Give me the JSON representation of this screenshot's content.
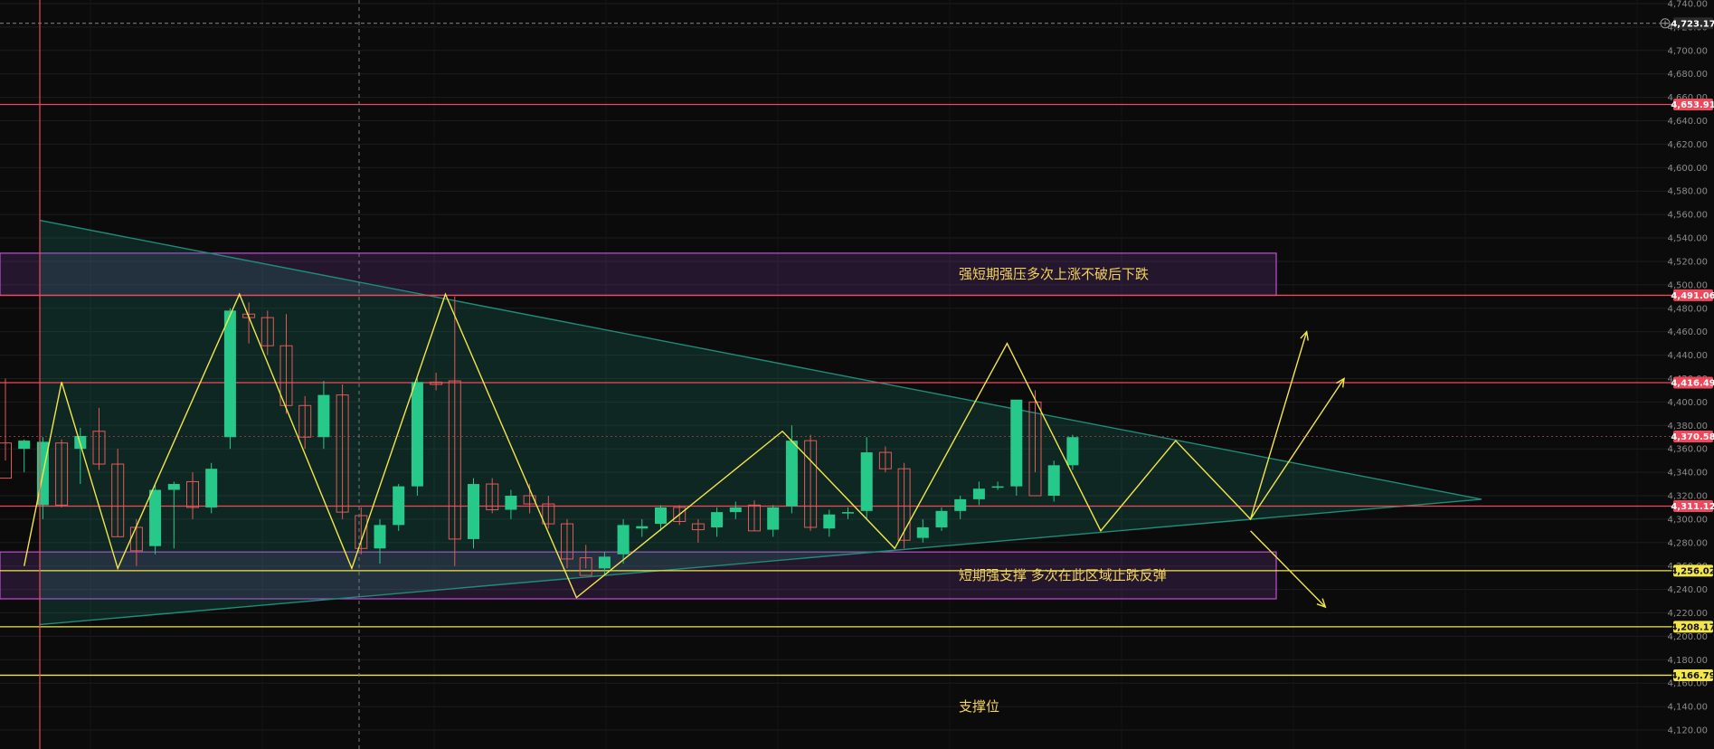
{
  "chart_data": {
    "type": "candlestick",
    "ylim": [
      4110,
      4740
    ],
    "y_ticks": [
      "4,740.00",
      "4,720.00",
      "4,700.00",
      "4,680.00",
      "4,660.00",
      "4,640.00",
      "4,620.00",
      "4,600.00",
      "4,580.00",
      "4,560.00",
      "4,540.00",
      "4,520.00",
      "4,500.00",
      "4,480.00",
      "4,460.00",
      "4,440.00",
      "4,420.00",
      "4,400.00",
      "4,380.00",
      "4,360.00",
      "4,340.00",
      "4,320.00",
      "4,300.00",
      "4,280.00",
      "4,260.00",
      "4,240.00",
      "4,220.00",
      "4,200.00",
      "4,180.00",
      "4,160.00",
      "4,140.00",
      "4,120.00"
    ],
    "grid": true,
    "colors": {
      "background": "#0b0b0b",
      "up": "#26c98a",
      "down": "#e05a5a",
      "red_line": "#f0485a",
      "yellow_line": "#f2e64b",
      "zigzag": "#f2e64b",
      "triangle": "#1f8c7a",
      "zone_border": "#c24dd8",
      "zone_label": "#f2d35b"
    },
    "candles": [
      {
        "o": 4365,
        "h": 4420,
        "l": 4350,
        "c": 4335
      },
      {
        "o": 4360,
        "h": 4368,
        "l": 4340,
        "c": 4367
      },
      {
        "o": 4312,
        "h": 4370,
        "l": 4300,
        "c": 4366
      },
      {
        "o": 4365,
        "h": 4368,
        "l": 4310,
        "c": 4312
      },
      {
        "o": 4360,
        "h": 4378,
        "l": 4330,
        "c": 4371
      },
      {
        "o": 4375,
        "h": 4395,
        "l": 4342,
        "c": 4347
      },
      {
        "o": 4347,
        "h": 4360,
        "l": 4285,
        "c": 4285
      },
      {
        "o": 4293,
        "h": 4300,
        "l": 4260,
        "c": 4273
      },
      {
        "o": 4277,
        "h": 4330,
        "l": 4270,
        "c": 4325
      },
      {
        "o": 4325,
        "h": 4332,
        "l": 4275,
        "c": 4330
      },
      {
        "o": 4332,
        "h": 4340,
        "l": 4300,
        "c": 4310
      },
      {
        "o": 4310,
        "h": 4348,
        "l": 4305,
        "c": 4343
      },
      {
        "o": 4370,
        "h": 4480,
        "l": 4360,
        "c": 4478
      },
      {
        "o": 4475,
        "h": 4485,
        "l": 4450,
        "c": 4472
      },
      {
        "o": 4472,
        "h": 4478,
        "l": 4440,
        "c": 4448
      },
      {
        "o": 4448,
        "h": 4475,
        "l": 4390,
        "c": 4397
      },
      {
        "o": 4397,
        "h": 4405,
        "l": 4360,
        "c": 4370
      },
      {
        "o": 4370,
        "h": 4418,
        "l": 4360,
        "c": 4406
      },
      {
        "o": 4406,
        "h": 4415,
        "l": 4300,
        "c": 4306
      },
      {
        "o": 4303,
        "h": 4310,
        "l": 4270,
        "c": 4275
      },
      {
        "o": 4275,
        "h": 4300,
        "l": 4262,
        "c": 4295
      },
      {
        "o": 4295,
        "h": 4330,
        "l": 4290,
        "c": 4328
      },
      {
        "o": 4328,
        "h": 4420,
        "l": 4320,
        "c": 4417
      },
      {
        "o": 4417,
        "h": 4425,
        "l": 4410,
        "c": 4415
      },
      {
        "o": 4418,
        "h": 4490,
        "l": 4260,
        "c": 4283
      },
      {
        "o": 4283,
        "h": 4335,
        "l": 4275,
        "c": 4330
      },
      {
        "o": 4330,
        "h": 4335,
        "l": 4305,
        "c": 4308
      },
      {
        "o": 4308,
        "h": 4325,
        "l": 4300,
        "c": 4320
      },
      {
        "o": 4320,
        "h": 4330,
        "l": 4305,
        "c": 4313
      },
      {
        "o": 4313,
        "h": 4320,
        "l": 4292,
        "c": 4296
      },
      {
        "o": 4296,
        "h": 4300,
        "l": 4258,
        "c": 4266
      },
      {
        "o": 4267,
        "h": 4278,
        "l": 4258,
        "c": 4252
      },
      {
        "o": 4258,
        "h": 4272,
        "l": 4252,
        "c": 4268
      },
      {
        "o": 4270,
        "h": 4300,
        "l": 4262,
        "c": 4295
      },
      {
        "o": 4292,
        "h": 4300,
        "l": 4285,
        "c": 4294
      },
      {
        "o": 4296,
        "h": 4312,
        "l": 4290,
        "c": 4310
      },
      {
        "o": 4310,
        "h": 4312,
        "l": 4295,
        "c": 4298
      },
      {
        "o": 4296,
        "h": 4300,
        "l": 4280,
        "c": 4291
      },
      {
        "o": 4293,
        "h": 4310,
        "l": 4285,
        "c": 4306
      },
      {
        "o": 4306,
        "h": 4315,
        "l": 4300,
        "c": 4310
      },
      {
        "o": 4312,
        "h": 4316,
        "l": 4290,
        "c": 4290
      },
      {
        "o": 4291,
        "h": 4312,
        "l": 4285,
        "c": 4310
      },
      {
        "o": 4311,
        "h": 4380,
        "l": 4305,
        "c": 4367
      },
      {
        "o": 4367,
        "h": 4372,
        "l": 4290,
        "c": 4293
      },
      {
        "o": 4292,
        "h": 4308,
        "l": 4285,
        "c": 4304
      },
      {
        "o": 4305,
        "h": 4310,
        "l": 4300,
        "c": 4306
      },
      {
        "o": 4307,
        "h": 4370,
        "l": 4300,
        "c": 4357
      },
      {
        "o": 4357,
        "h": 4362,
        "l": 4340,
        "c": 4343
      },
      {
        "o": 4343,
        "h": 4348,
        "l": 4275,
        "c": 4282
      },
      {
        "o": 4284,
        "h": 4300,
        "l": 4280,
        "c": 4293
      },
      {
        "o": 4293,
        "h": 4310,
        "l": 4290,
        "c": 4307
      },
      {
        "o": 4307,
        "h": 4320,
        "l": 4300,
        "c": 4317
      },
      {
        "o": 4317,
        "h": 4332,
        "l": 4312,
        "c": 4326
      },
      {
        "o": 4328,
        "h": 4332,
        "l": 4325,
        "c": 4328
      },
      {
        "o": 4328,
        "h": 4402,
        "l": 4320,
        "c": 4402
      },
      {
        "o": 4400,
        "h": 4410,
        "l": 4340,
        "c": 4320
      },
      {
        "o": 4320,
        "h": 4350,
        "l": 4315,
        "c": 4346
      },
      {
        "o": 4346,
        "h": 4372,
        "l": 4342,
        "c": 4370
      }
    ],
    "horizontal_levels": [
      {
        "price": 4723.17,
        "label": "4,723.17",
        "style": "dashed-white"
      },
      {
        "price": 4653.91,
        "label": "4,653.91",
        "style": "red"
      },
      {
        "price": 4491.06,
        "label": "4,491.06",
        "style": "red"
      },
      {
        "price": 4416.49,
        "label": "4,416.49",
        "style": "red"
      },
      {
        "price": 4370.58,
        "label": "4,370.58",
        "style": "red-dotted"
      },
      {
        "price": 4311.12,
        "label": "4,311.12",
        "style": "red"
      },
      {
        "price": 4256.02,
        "label": "4,256.02",
        "style": "yellow"
      },
      {
        "price": 4208.17,
        "label": "4,208.17",
        "style": "yellow"
      },
      {
        "price": 4166.79,
        "label": "4,166.79",
        "style": "yellow"
      }
    ],
    "zones": [
      {
        "from": 4491,
        "to": 4527,
        "label": "强短期强压多次上涨不破后下跌"
      },
      {
        "from": 4232,
        "to": 4272,
        "label": "短期强支撑 多次在此区域止跌反弹"
      }
    ],
    "annotations": [
      {
        "price": 4140,
        "text": "支撑位"
      }
    ],
    "triangle": {
      "apex_bar": 80.5,
      "apex_price": 4317,
      "left_bar": 1,
      "upper_price": 4555,
      "lower_price": 4210
    },
    "zigzag": [
      [
        1,
        4260
      ],
      [
        3,
        4417
      ],
      [
        6,
        4258
      ],
      [
        12.5,
        4492
      ],
      [
        18.5,
        4258
      ],
      [
        23.5,
        4492
      ],
      [
        30.5,
        4233
      ],
      [
        41.5,
        4375
      ],
      [
        47.5,
        4275
      ],
      [
        53.5,
        4450
      ],
      [
        58.5,
        4290
      ],
      [
        62.5,
        4367
      ],
      [
        66.5,
        4300
      ],
      [
        69.5,
        4460
      ]
    ],
    "zigzag2": [
      [
        66.5,
        4300
      ],
      [
        71.5,
        4420
      ]
    ],
    "down_arrow": [
      [
        66.5,
        4290
      ],
      [
        70.5,
        4225
      ]
    ]
  }
}
